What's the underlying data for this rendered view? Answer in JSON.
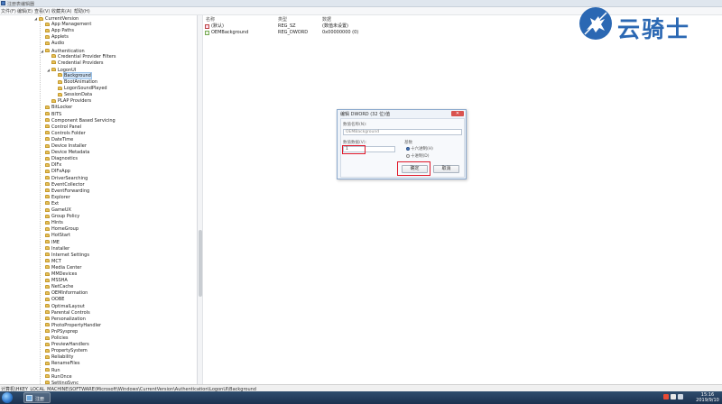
{
  "window": {
    "title": "注册表编辑器"
  },
  "menu": [
    "文件(F)",
    "编辑(E)",
    "查看(V)",
    "收藏夹(A)",
    "帮助(H)"
  ],
  "tree": [
    {
      "label": "CurrentVersion",
      "exp": "◢",
      "level": 0
    },
    {
      "label": "App Management",
      "level": 1
    },
    {
      "label": "App Paths",
      "level": 1
    },
    {
      "label": "Applets",
      "level": 1
    },
    {
      "label": "Audio",
      "level": 1
    },
    {
      "label": "Authentication",
      "exp": "◢",
      "level": 1
    },
    {
      "label": "Credential Provider Filters",
      "level": 2
    },
    {
      "label": "Credential Providers",
      "level": 2
    },
    {
      "label": "LogonUI",
      "exp": "◢",
      "level": 2
    },
    {
      "label": "Background",
      "level": 3,
      "selected": true
    },
    {
      "label": "BootAnimation",
      "level": 3
    },
    {
      "label": "LogonSoundPlayed",
      "level": 3
    },
    {
      "label": "SessionData",
      "level": 3
    },
    {
      "label": "PLAP Providers",
      "level": 2
    },
    {
      "label": "BitLocker",
      "level": 1
    },
    {
      "label": "BITS",
      "level": 1
    },
    {
      "label": "Component Based Servicing",
      "level": 1
    },
    {
      "label": "Control Panel",
      "level": 1
    },
    {
      "label": "Controls Folder",
      "level": 1
    },
    {
      "label": "DateTime",
      "level": 1
    },
    {
      "label": "Device Installer",
      "level": 1
    },
    {
      "label": "Device Metadata",
      "level": 1
    },
    {
      "label": "Diagnostics",
      "level": 1
    },
    {
      "label": "DIFx",
      "level": 1
    },
    {
      "label": "DIFxApp",
      "level": 1
    },
    {
      "label": "DriverSearching",
      "level": 1
    },
    {
      "label": "EventCollector",
      "level": 1
    },
    {
      "label": "EventForwarding",
      "level": 1
    },
    {
      "label": "Explorer",
      "level": 1
    },
    {
      "label": "Ext",
      "level": 1
    },
    {
      "label": "GameUX",
      "level": 1
    },
    {
      "label": "Group Policy",
      "level": 1
    },
    {
      "label": "Hints",
      "level": 1
    },
    {
      "label": "HomeGroup",
      "level": 1
    },
    {
      "label": "HotStart",
      "level": 1
    },
    {
      "label": "IME",
      "level": 1
    },
    {
      "label": "Installer",
      "level": 1
    },
    {
      "label": "Internet Settings",
      "level": 1
    },
    {
      "label": "MCT",
      "level": 1
    },
    {
      "label": "Media Center",
      "level": 1
    },
    {
      "label": "MMDevices",
      "level": 1
    },
    {
      "label": "MSSHA",
      "level": 1
    },
    {
      "label": "NetCache",
      "level": 1
    },
    {
      "label": "OEMInformation",
      "level": 1
    },
    {
      "label": "OOBE",
      "level": 1
    },
    {
      "label": "OptimalLayout",
      "level": 1
    },
    {
      "label": "Parental Controls",
      "level": 1
    },
    {
      "label": "Personalization",
      "level": 1
    },
    {
      "label": "PhotoPropertyHandler",
      "level": 1
    },
    {
      "label": "PnPSysprep",
      "level": 1
    },
    {
      "label": "Policies",
      "level": 1
    },
    {
      "label": "PreviewHandlers",
      "level": 1
    },
    {
      "label": "PropertySystem",
      "level": 1
    },
    {
      "label": "Reliability",
      "level": 1
    },
    {
      "label": "RenameFiles",
      "level": 1
    },
    {
      "label": "Run",
      "level": 1
    },
    {
      "label": "RunOnce",
      "level": 1
    },
    {
      "label": "SettingSync",
      "level": 1
    }
  ],
  "list": {
    "headers": {
      "name": "名称",
      "type": "类型",
      "data": "数据"
    },
    "rows": [
      {
        "name": "(默认)",
        "type": "REG_SZ",
        "data": "(数值未设置)",
        "icon": "sz"
      },
      {
        "name": "OEMBackground",
        "type": "REG_DWORD",
        "data": "0x00000000 (0)",
        "icon": "dword"
      }
    ]
  },
  "dialog": {
    "title": "编辑 DWORD (32 位)值",
    "close": "✕",
    "name_label": "数值名称(N):",
    "name_value": "OEMBackground",
    "data_label": "数值数据(V):",
    "data_value": "1",
    "base_label": "基数",
    "hex_label": "十六进制(H)",
    "dec_label": "十进制(D)",
    "ok_label": "确定",
    "cancel_label": "取消"
  },
  "status": {
    "path": "计算机\\HKEY_LOCAL_MACHINE\\SOFTWARE\\Microsoft\\Windows\\CurrentVersion\\Authentication\\LogonUI\\Background"
  },
  "taskbar": {
    "task_label": "注册",
    "time": "15:16",
    "date": "2019/9/10"
  },
  "watermark": {
    "text": "云骑士",
    "color": "#2b68b3"
  }
}
